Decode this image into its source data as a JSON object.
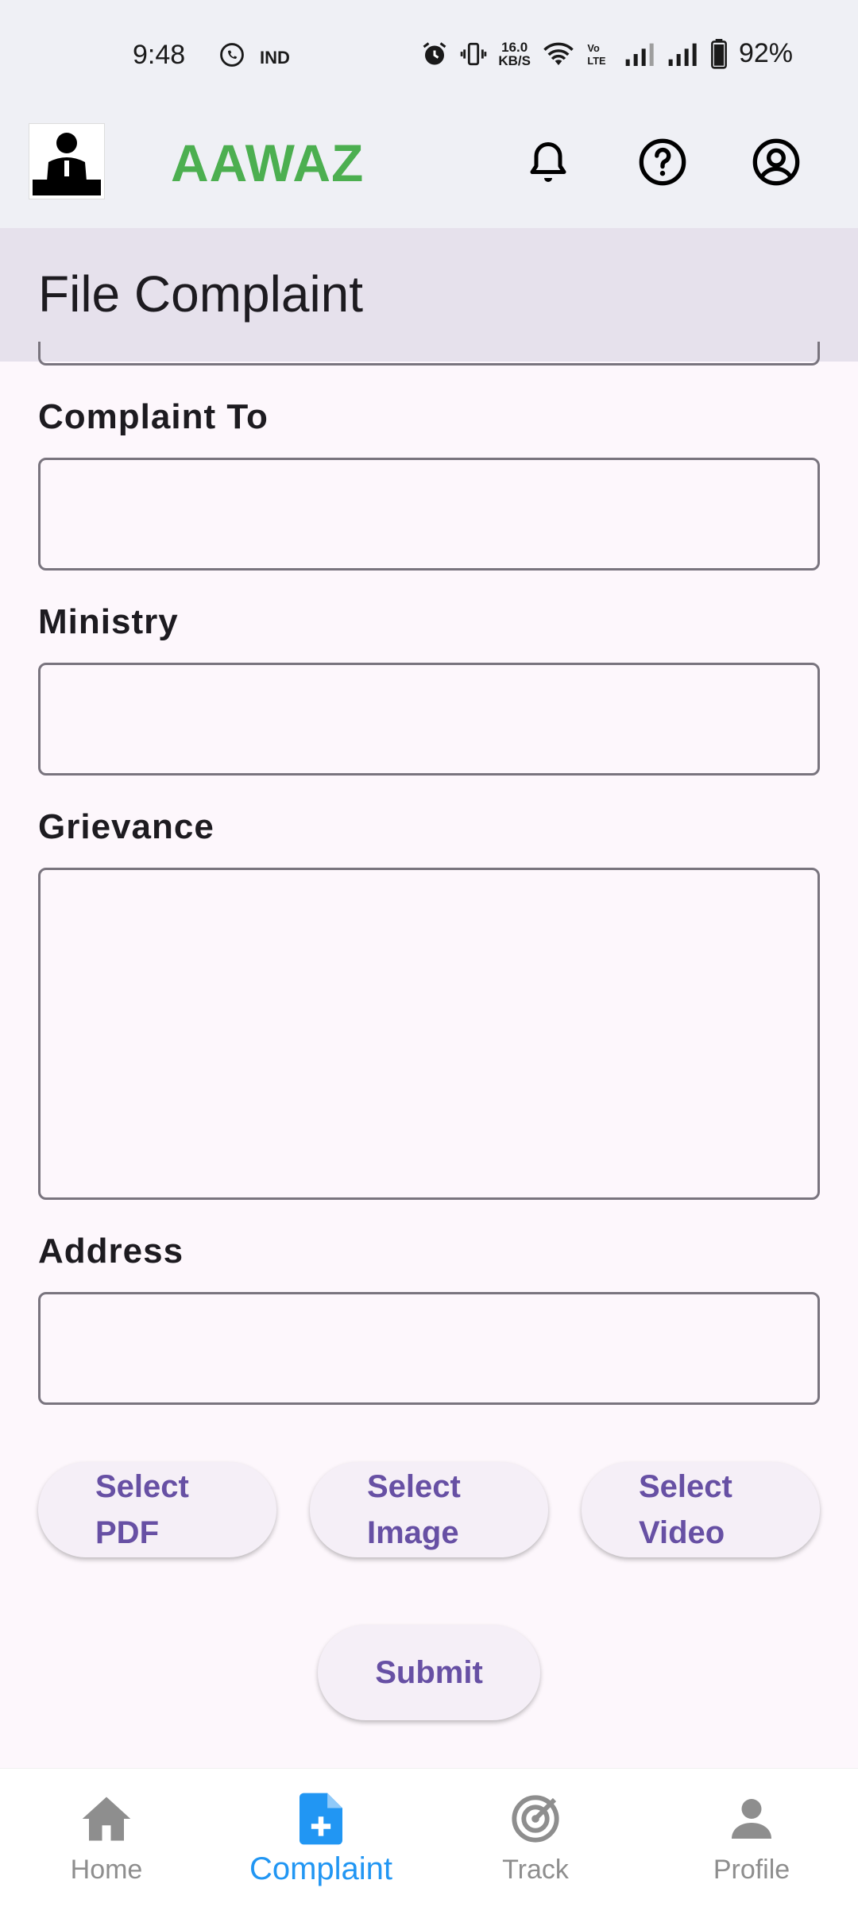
{
  "status_bar": {
    "time": "9:48",
    "net_speed_top": "16.0",
    "net_speed_bottom": "KB/S",
    "battery": "92%"
  },
  "app_bar": {
    "title": "AAWAZ",
    "title_color": "#4caf50",
    "icons": [
      "bell-icon",
      "help-icon",
      "account-icon"
    ]
  },
  "page": {
    "title": "File Complaint"
  },
  "form": {
    "complaint_to_label": "Complaint To",
    "ministry_label": "Ministry",
    "grievance_label": "Grievance",
    "address_label": "Address",
    "complaint_to_value": "",
    "ministry_value": "",
    "grievance_value": "",
    "address_value": ""
  },
  "attachments": {
    "pdf_line1": "Select",
    "pdf_line2": "PDF",
    "image_line1": "Select",
    "image_line2": "Image",
    "video_line1": "Select",
    "video_line2": "Video"
  },
  "submit_label": "Submit",
  "bottom_nav": {
    "home": "Home",
    "complaint": "Complaint",
    "track": "Track",
    "profile": "Profile",
    "active": "Complaint",
    "active_color": "#2196f3"
  }
}
